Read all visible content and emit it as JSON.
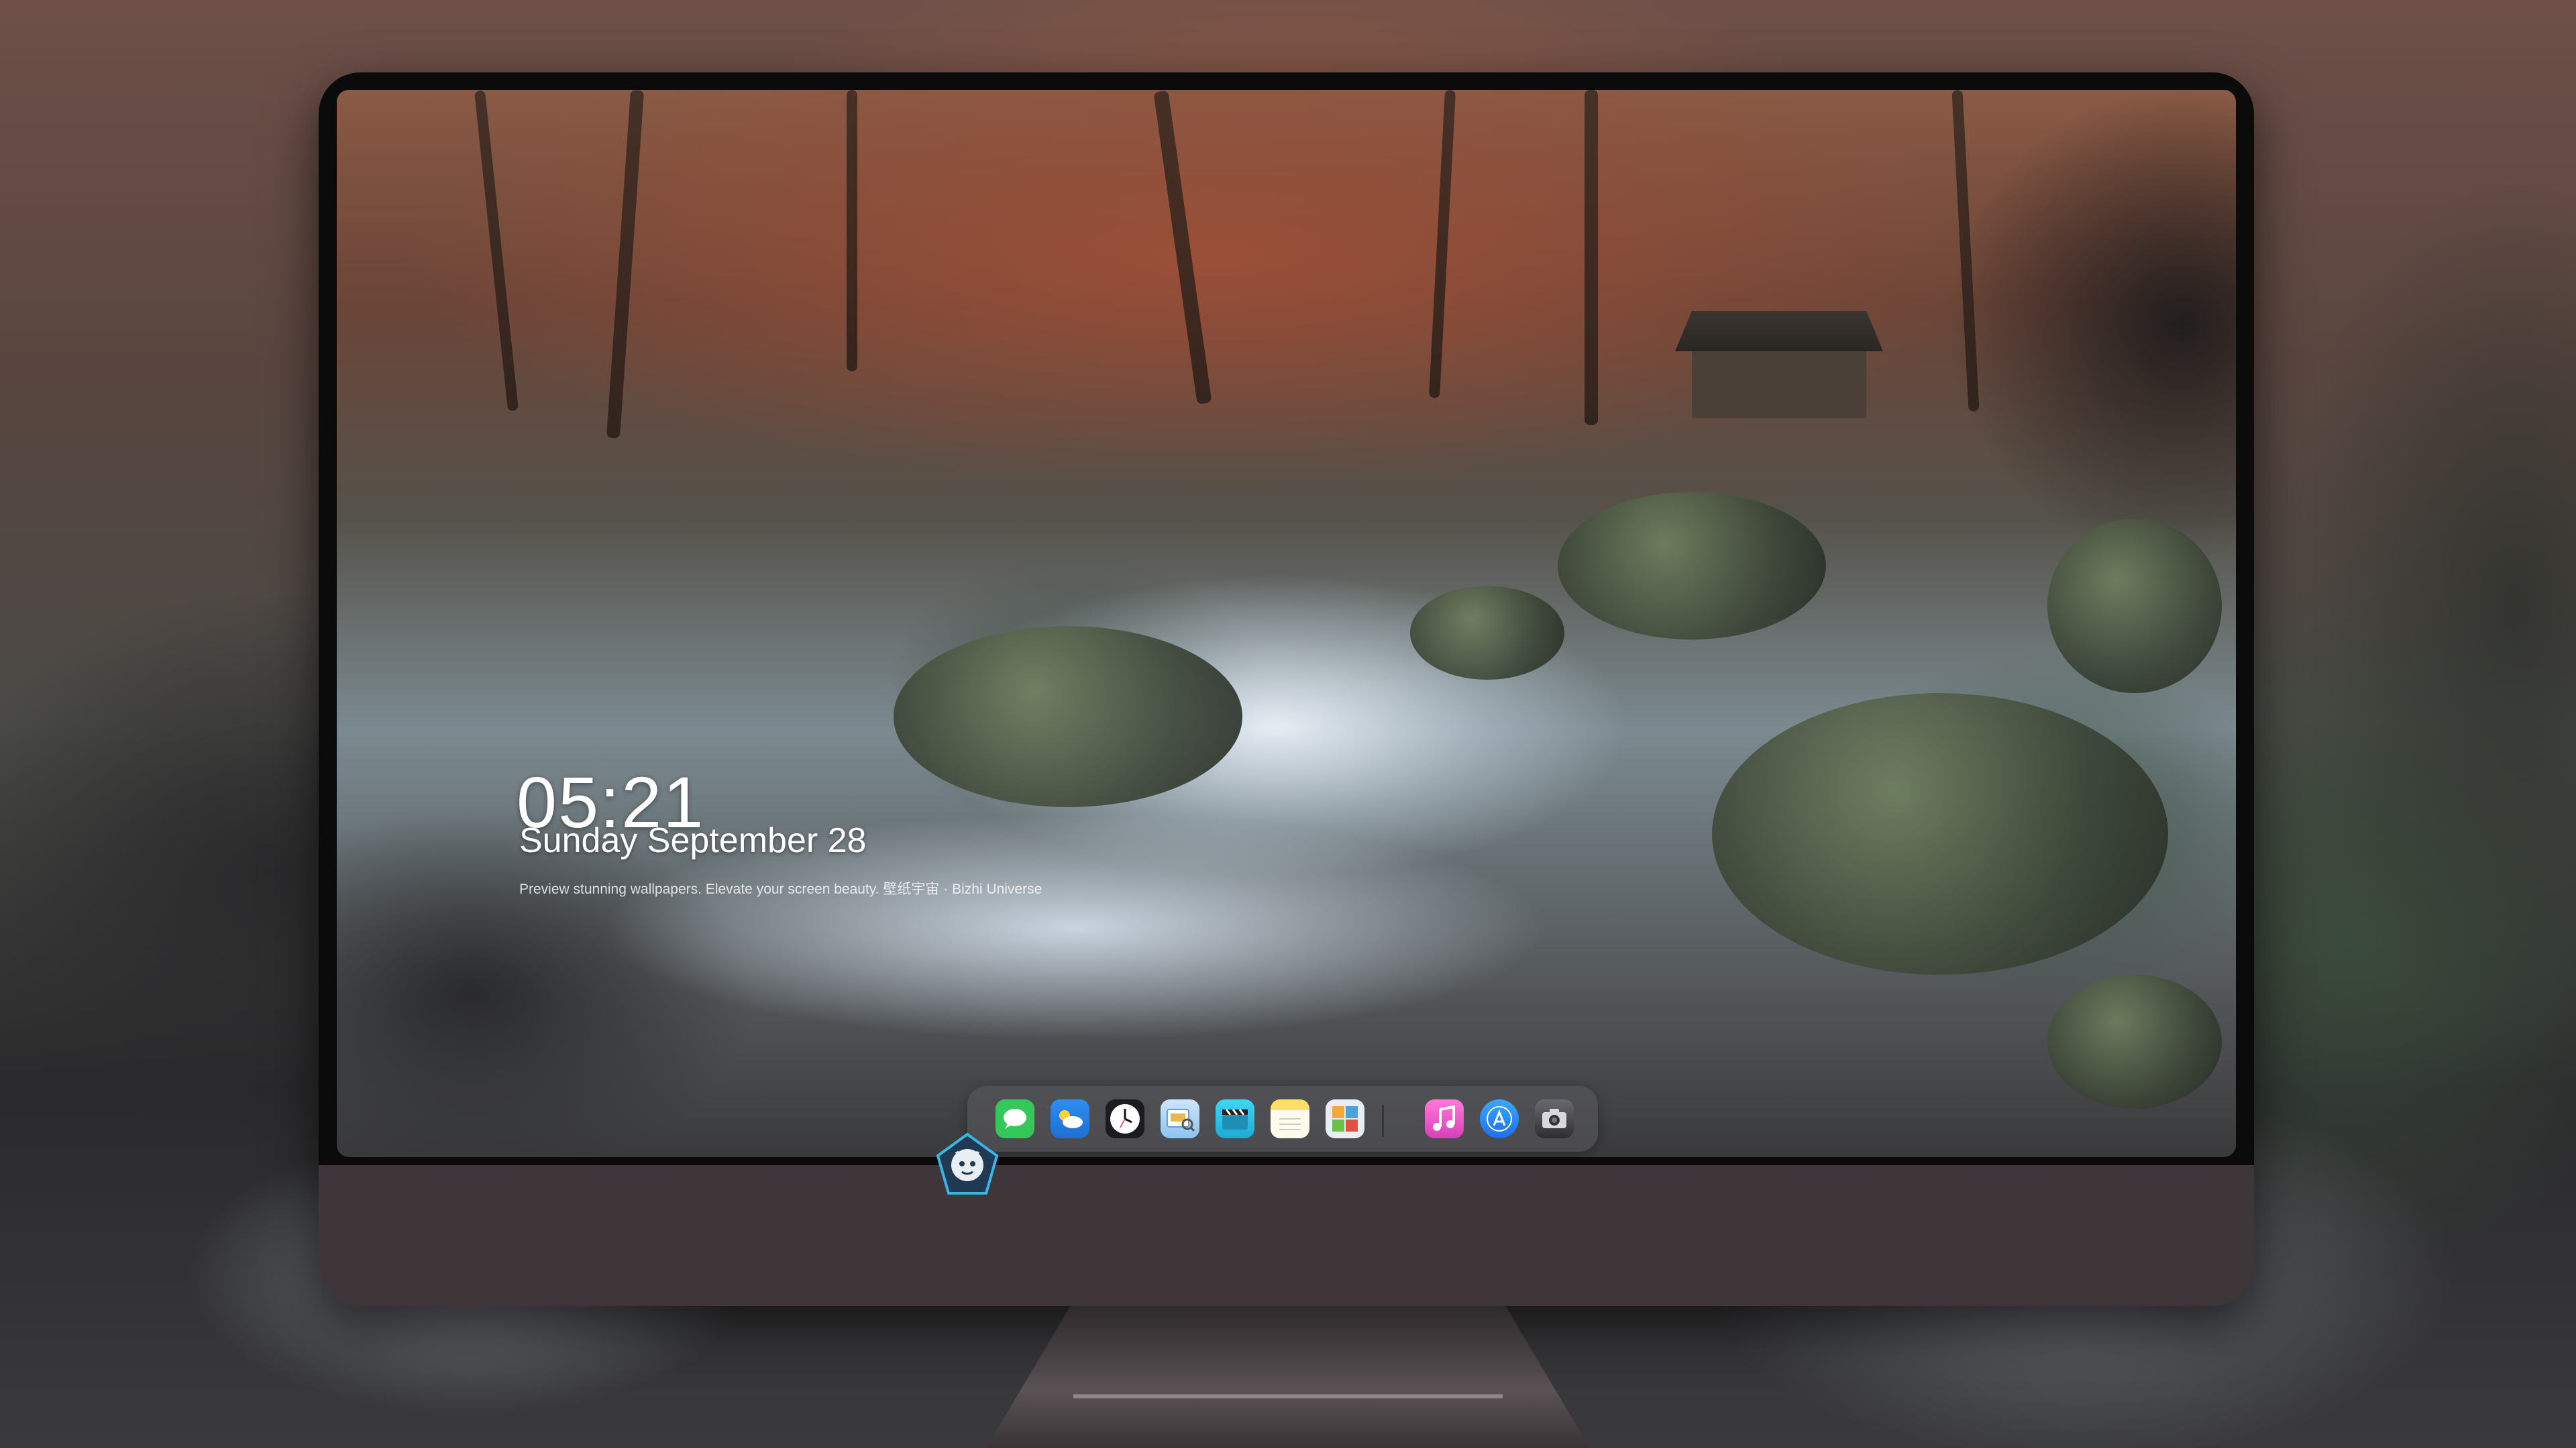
{
  "lockscreen": {
    "time": "05:21",
    "date": "Sunday September  28",
    "tagline": "Preview stunning wallpapers. Elevate your screen beauty. 壁纸宇宙 · Bizhi Universe"
  },
  "dock": {
    "apps": [
      {
        "name": "Messages",
        "icon": "message-bubble-icon",
        "color": "#34c759"
      },
      {
        "name": "Weather",
        "icon": "weather-cloud-icon",
        "color": "#2e8ef0"
      },
      {
        "name": "Clock",
        "icon": "clock-icon",
        "color": "#1c1c1e"
      },
      {
        "name": "Preview",
        "icon": "preview-icon",
        "color": "#8bc3f0"
      },
      {
        "name": "Clips",
        "icon": "clapperboard-icon",
        "color": "#27c3e6"
      },
      {
        "name": "Notes",
        "icon": "notes-icon",
        "color": "#ffd42a"
      },
      {
        "name": "Photo Booth",
        "icon": "photo-grid-icon",
        "color": "#e8eef6"
      },
      {
        "name": "Music",
        "icon": "music-note-icon",
        "color": "#fb5bc5"
      },
      {
        "name": "App Store",
        "icon": "app-store-icon",
        "color": "#1e90ff"
      },
      {
        "name": "Camera",
        "icon": "camera-icon",
        "color": "#3a3a3c"
      }
    ]
  },
  "colors": {
    "monitor_body": "#3d3538",
    "bezel": "#0c0b0c",
    "logo_accent": "#38b6e8"
  }
}
